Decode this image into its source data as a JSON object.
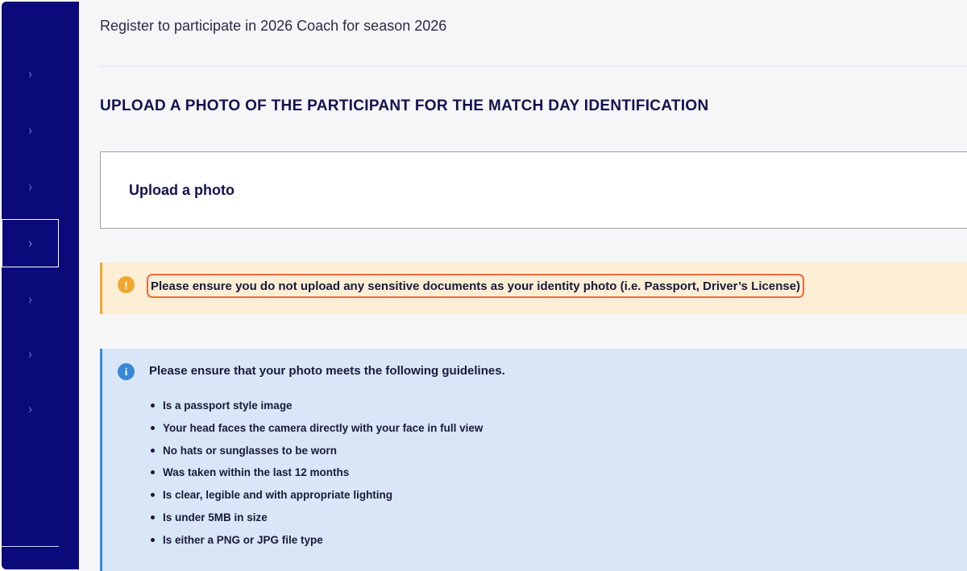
{
  "sidebar": {
    "items": [
      {
        "icon": "chevron-right-icon",
        "glyph": "›"
      },
      {
        "icon": "chevron-right-icon",
        "glyph": "›"
      },
      {
        "icon": "chevron-right-icon",
        "glyph": "›"
      },
      {
        "icon": "chevron-right-icon",
        "glyph": "›",
        "active": true
      },
      {
        "icon": "chevron-right-icon",
        "glyph": "›"
      },
      {
        "icon": "chevron-right-icon",
        "glyph": "›"
      },
      {
        "icon": "chevron-right-icon",
        "glyph": "›"
      }
    ]
  },
  "header": {
    "subtitle": "Register to participate in 2026 Coach for season 2026"
  },
  "section": {
    "title": "UPLOAD A PHOTO OF THE PARTICIPANT FOR THE MATCH DAY IDENTIFICATION"
  },
  "upload": {
    "label": "Upload a photo"
  },
  "warning": {
    "icon": "exclamation-icon",
    "glyph": "!",
    "text": "Please ensure you do not upload any sensitive documents as your identity photo (i.e. Passport, Driver’s License)"
  },
  "info": {
    "icon": "info-icon",
    "glyph": "i",
    "title": "Please ensure that your photo meets the following guidelines.",
    "guidelines": [
      "Is a passport style image",
      "Your head faces the camera directly with your face in full view",
      "No hats or sunglasses to be worn",
      "Was taken within the last 12 months",
      "Is clear, legible and with appropriate lighting",
      "Is under 5MB in size",
      "Is either a PNG or JPG file type"
    ]
  },
  "colors": {
    "sidebar": "#0a0a7a",
    "warning_bg": "#fdeed6",
    "warning_accent": "#f0a82c",
    "highlight": "#f06a3a",
    "info_bg": "#d8e6f7",
    "info_accent": "#3a86d8"
  }
}
